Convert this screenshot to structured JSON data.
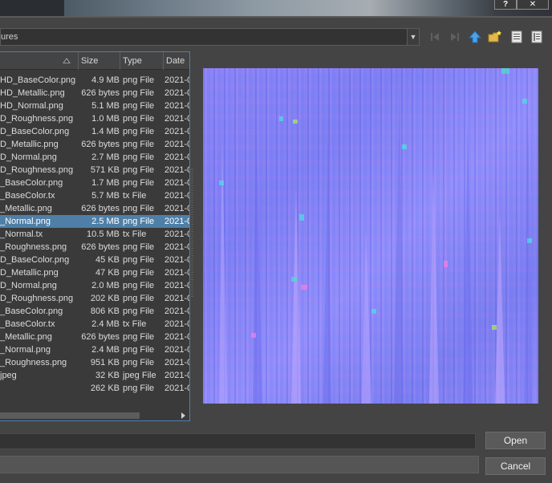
{
  "titlebar": {
    "help_label": "?",
    "close_label": "✕"
  },
  "path": {
    "text": "ures"
  },
  "nav_icons": [
    "back-icon",
    "forward-icon",
    "up-folder-icon",
    "new-folder-icon",
    "list-view-icon",
    "details-view-icon"
  ],
  "columns": {
    "name": "",
    "size": "Size",
    "type": "Type",
    "date": "Date"
  },
  "files": [
    {
      "name": "HD_BaseColor.png",
      "size": "4.9 MB",
      "type": "png File",
      "date": "2021-0"
    },
    {
      "name": "HD_Metallic.png",
      "size": "626 bytes",
      "type": "png File",
      "date": "2021-0"
    },
    {
      "name": "HD_Normal.png",
      "size": "5.1 MB",
      "type": "png File",
      "date": "2021-0"
    },
    {
      "name": "D_Roughness.png",
      "size": "1.0 MB",
      "type": "png File",
      "date": "2021-0"
    },
    {
      "name": "D_BaseColor.png",
      "size": "1.4 MB",
      "type": "png File",
      "date": "2021-0"
    },
    {
      "name": "D_Metallic.png",
      "size": "626 bytes",
      "type": "png File",
      "date": "2021-0"
    },
    {
      "name": "D_Normal.png",
      "size": "2.7 MB",
      "type": "png File",
      "date": "2021-0"
    },
    {
      "name": "D_Roughness.png",
      "size": "571 KB",
      "type": "png File",
      "date": "2021-0"
    },
    {
      "name": "_BaseColor.png",
      "size": "1.7 MB",
      "type": "png File",
      "date": "2021-0"
    },
    {
      "name": "_BaseColor.tx",
      "size": "5.7 MB",
      "type": "tx File",
      "date": "2021-0"
    },
    {
      "name": "_Metallic.png",
      "size": "626 bytes",
      "type": "png File",
      "date": "2021-0"
    },
    {
      "name": "_Normal.png",
      "size": "2.5 MB",
      "type": "png File",
      "date": "2021-0"
    },
    {
      "name": "_Normal.tx",
      "size": "10.5 MB",
      "type": "tx File",
      "date": "2021-0"
    },
    {
      "name": "_Roughness.png",
      "size": "626 bytes",
      "type": "png File",
      "date": "2021-0"
    },
    {
      "name": "D_BaseColor.png",
      "size": "45 KB",
      "type": "png File",
      "date": "2021-0"
    },
    {
      "name": "D_Metallic.png",
      "size": "47 KB",
      "type": "png File",
      "date": "2021-0"
    },
    {
      "name": "D_Normal.png",
      "size": "2.0 MB",
      "type": "png File",
      "date": "2021-0"
    },
    {
      "name": "D_Roughness.png",
      "size": "202 KB",
      "type": "png File",
      "date": "2021-0"
    },
    {
      "name": "_BaseColor.png",
      "size": "806 KB",
      "type": "png File",
      "date": "2021-0"
    },
    {
      "name": "_BaseColor.tx",
      "size": "2.4 MB",
      "type": "tx File",
      "date": "2021-0"
    },
    {
      "name": "_Metallic.png",
      "size": "626 bytes",
      "type": "png File",
      "date": "2021-0"
    },
    {
      "name": "_Normal.png",
      "size": "2.4 MB",
      "type": "png File",
      "date": "2021-0"
    },
    {
      "name": "_Roughness.png",
      "size": "951 KB",
      "type": "png File",
      "date": "2021-0"
    },
    {
      "name": "jpeg",
      "size": "32 KB",
      "type": "jpeg File",
      "date": "2021-0"
    },
    {
      "name": "",
      "size": "262 KB",
      "type": "png File",
      "date": "2021-0"
    }
  ],
  "selected_index": 11,
  "filename_value": "",
  "filter_value": "",
  "buttons": {
    "open": "Open",
    "cancel": "Cancel"
  },
  "colors": {
    "selection": "#4f7fa6",
    "panel": "#3a3a3a",
    "background": "#444444",
    "preview_tint": "#8a85f5"
  }
}
